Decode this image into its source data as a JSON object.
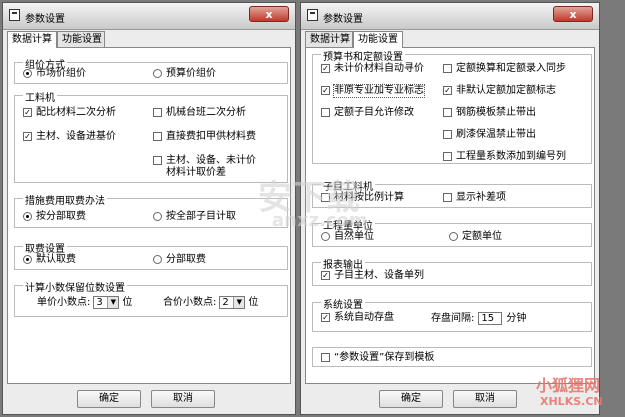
{
  "win1": {
    "title": "参数设置",
    "close_label": "x",
    "tabs": [
      {
        "label": "数据计算"
      },
      {
        "label": "功能设置"
      }
    ],
    "groups": {
      "pricing": {
        "title": "组价方式",
        "options": [
          "市场价组价",
          "预算价组价"
        ]
      },
      "labor": {
        "title": "工料机",
        "options": [
          "配比材料二次分析",
          "机械台班二次分析",
          "主材、设备进基价",
          "直接费扣甲供材料费",
          "主材、设备、未计价材料计取价差"
        ]
      },
      "measure": {
        "title": "措施费用取费办法",
        "options": [
          "按分部取费",
          "按全部子目计取"
        ]
      },
      "fee": {
        "title": "取费设置",
        "options": [
          "默认取费",
          "分部取费"
        ]
      },
      "decimals": {
        "title": "计算小数保留位数设置",
        "unit_label": "单价小数点:",
        "unit_value": "3",
        "unit_suffix": "位",
        "total_label": "合价小数点:",
        "total_value": "2",
        "total_suffix": "位"
      }
    },
    "ok_label": "确定",
    "cancel_label": "取消"
  },
  "win2": {
    "title": "参数设置",
    "close_label": "x",
    "tabs": [
      {
        "label": "数据计算"
      },
      {
        "label": "功能设置"
      }
    ],
    "groups": {
      "budget": {
        "title": "预算书和定额设置",
        "options": [
          "未计价材料自动寻价",
          "定额换算和定额录入同步",
          "非原专业加专业标志",
          "非默认定额加定额标志",
          "定额子目允许修改",
          "钢筋模板禁止带出",
          "刷漆保温禁止带出",
          "工程量系数添加到编号列"
        ]
      },
      "sub": {
        "title": "子目工料机",
        "options": [
          "材料按比例计算",
          "显示补差项"
        ]
      },
      "qty": {
        "title": "工程量单位",
        "options": [
          "自然单位",
          "定额单位"
        ]
      },
      "report": {
        "title": "报表输出",
        "options": [
          "子目主材、设备单列"
        ]
      },
      "sys": {
        "title": "系统设置",
        "options": [
          "系统自动存盘"
        ],
        "interval_label": "存盘间隔:",
        "interval_value": "15",
        "interval_unit": "分钟"
      },
      "template_option": "“参数设置”保存到模板"
    },
    "ok_label": "确定",
    "cancel_label": "取消"
  },
  "watermark": {
    "text1": "安下载",
    "text2": "anxz.com",
    "text3": "小狐狸网",
    "text4": "XHLKS.CN"
  }
}
